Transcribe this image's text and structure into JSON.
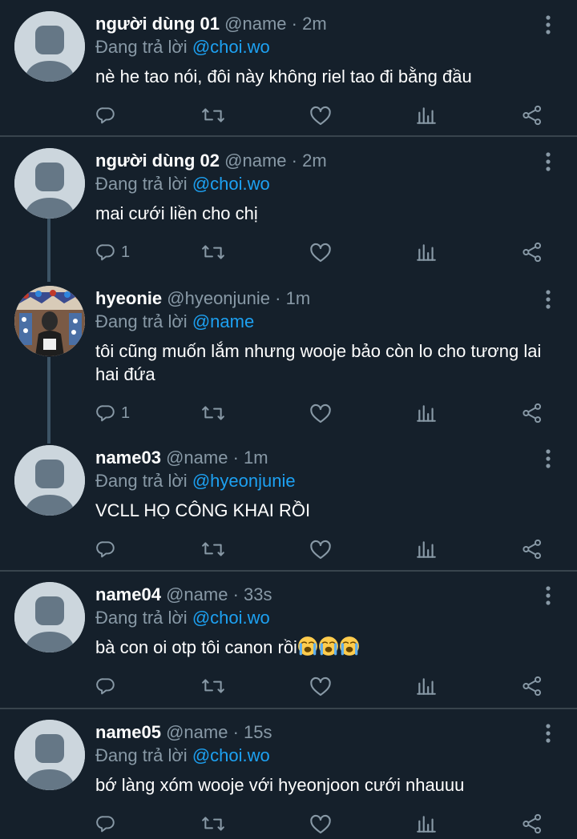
{
  "reply_prefix": "Đang trả lời",
  "dot": "·",
  "tweets": [
    {
      "display_name": "người dùng 01",
      "handle": "@name",
      "time": "2m",
      "reply_to": "@choi.wo",
      "text": "nè he tao nói, đôi này không riel tao đi bằng đầu",
      "reply_count": ""
    },
    {
      "display_name": "người dùng 02",
      "handle": "@name",
      "time": "2m",
      "reply_to": "@choi.wo",
      "text": "mai cưới liền cho chị",
      "reply_count": "1"
    },
    {
      "display_name": "hyeonie",
      "handle": "@hyeonjunie",
      "time": "1m",
      "reply_to": "@name",
      "text": "tôi cũng muốn lắm nhưng wooje bảo còn lo cho tương lai hai đứa",
      "reply_count": "1"
    },
    {
      "display_name": "name03",
      "handle": "@name",
      "time": "1m",
      "reply_to": "@hyeonjunie",
      "text": "VCLL HỌ CÔNG KHAI RỒI",
      "reply_count": ""
    },
    {
      "display_name": "name04",
      "handle": "@name",
      "time": "33s",
      "reply_to": "@choi.wo",
      "text": "bà con oi otp tôi canon rồi",
      "reply_count": "",
      "emoji_count": 3,
      "emoji_name": "loudly-crying-face"
    },
    {
      "display_name": "name05",
      "handle": "@name",
      "time": "15s",
      "reply_to": "@choi.wo",
      "text": "bớ làng xóm wooje với hyeonjoon cưới nhauuu",
      "reply_count": ""
    }
  ],
  "icons": {
    "reply": "reply-icon",
    "retweet": "retweet-icon",
    "like": "heart-icon",
    "stats": "analytics-icon",
    "share": "share-icon",
    "more": "more-vertical-icon"
  },
  "colors": {
    "background": "#15202b",
    "divider": "#38444d",
    "secondary_text": "#8899a6",
    "link": "#1da1f2",
    "thread_line": "#3d5466",
    "avatar_placeholder": "#ccd6dd",
    "avatar_silhouette": "#657786"
  }
}
